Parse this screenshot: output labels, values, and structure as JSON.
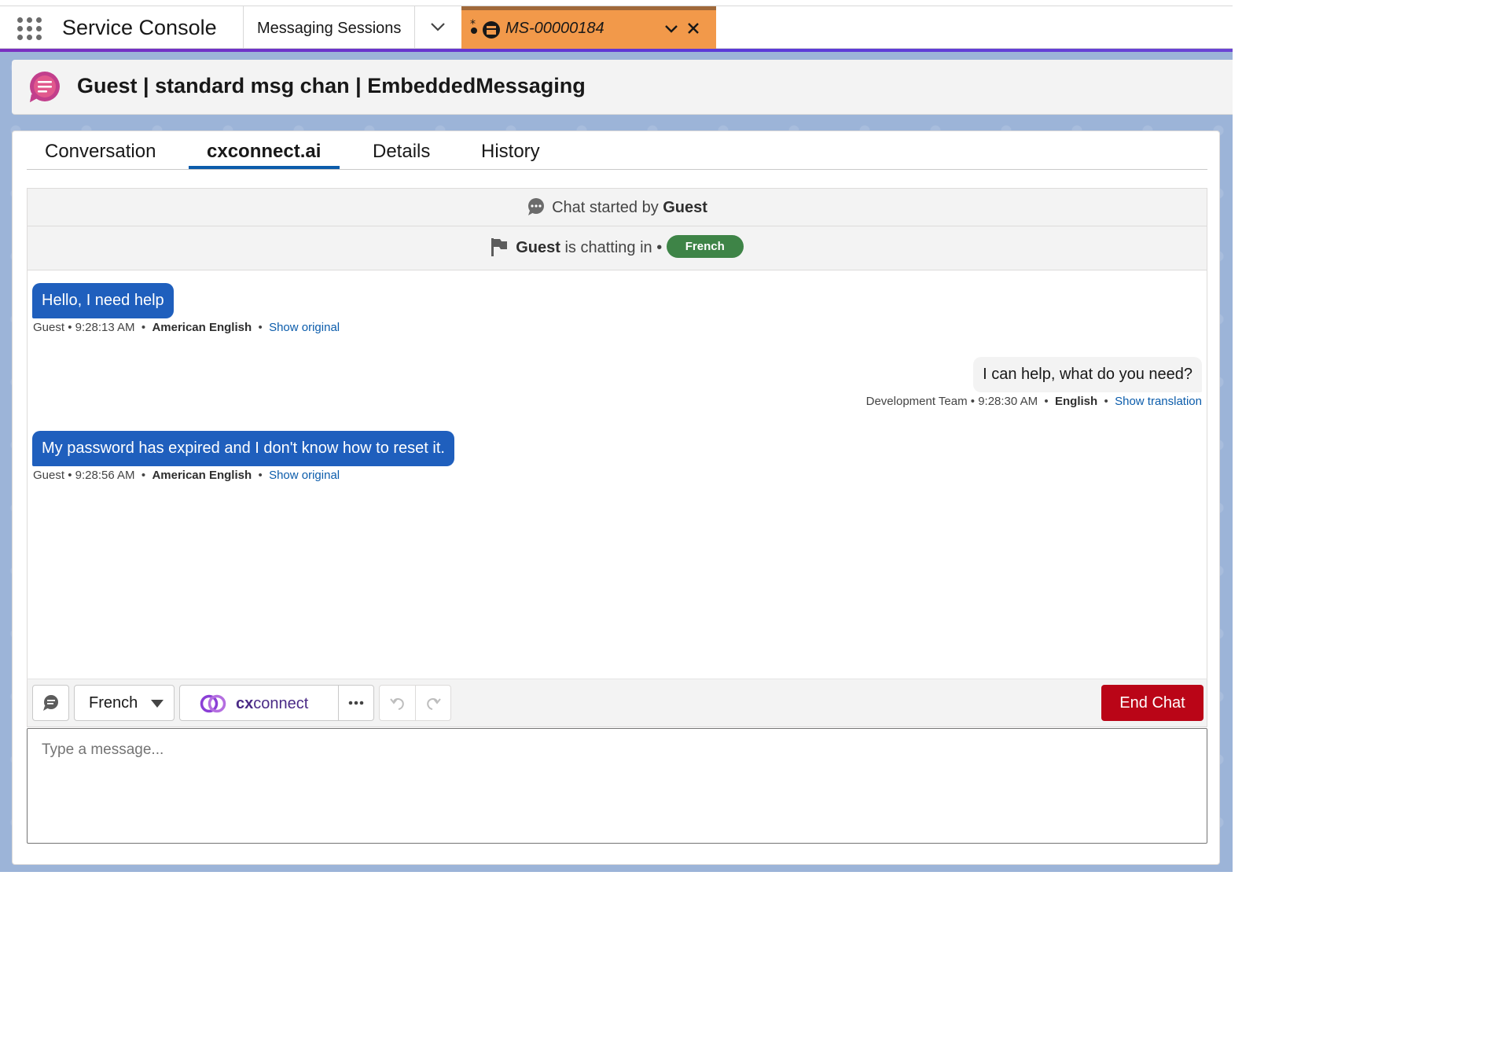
{
  "nav": {
    "app_name": "Service Console",
    "object_tab": "Messaging Sessions",
    "record_tab": "MS-00000184"
  },
  "record": {
    "title": "Guest | standard msg chan | EmbeddedMessaging"
  },
  "tabs": [
    {
      "label": "Conversation"
    },
    {
      "label": "cxconnect.ai"
    },
    {
      "label": "Details"
    },
    {
      "label": "History"
    }
  ],
  "system": {
    "started_prefix": "Chat started by",
    "started_by": "Guest",
    "chatting_who": "Guest",
    "chatting_text": "is chatting in •",
    "language": "French"
  },
  "messages": [
    {
      "text": "Hello, I need help",
      "sender": "Guest",
      "time": "9:28:13 AM",
      "language": "American English",
      "action": "Show original"
    },
    {
      "text": "I can help, what do you need?",
      "sender": "Development Team",
      "time": "9:28:30 AM",
      "language": "English",
      "action": "Show translation"
    },
    {
      "text": "My password has expired and I don't know how to reset it.",
      "sender": "Guest",
      "time": "9:28:56 AM",
      "language": "American English",
      "action": "Show original"
    }
  ],
  "toolbar": {
    "language": "French",
    "brand_bold": "cx",
    "brand_rest": "connect",
    "end_chat": "End Chat"
  },
  "composer": {
    "placeholder": "Type a message..."
  },
  "colors": {
    "record_tab": "#f2994a",
    "inbound_bubble": "#1f5fbd",
    "language_pill": "#3e8447",
    "end_chat": "#ba0517",
    "link": "#0b5cab"
  }
}
